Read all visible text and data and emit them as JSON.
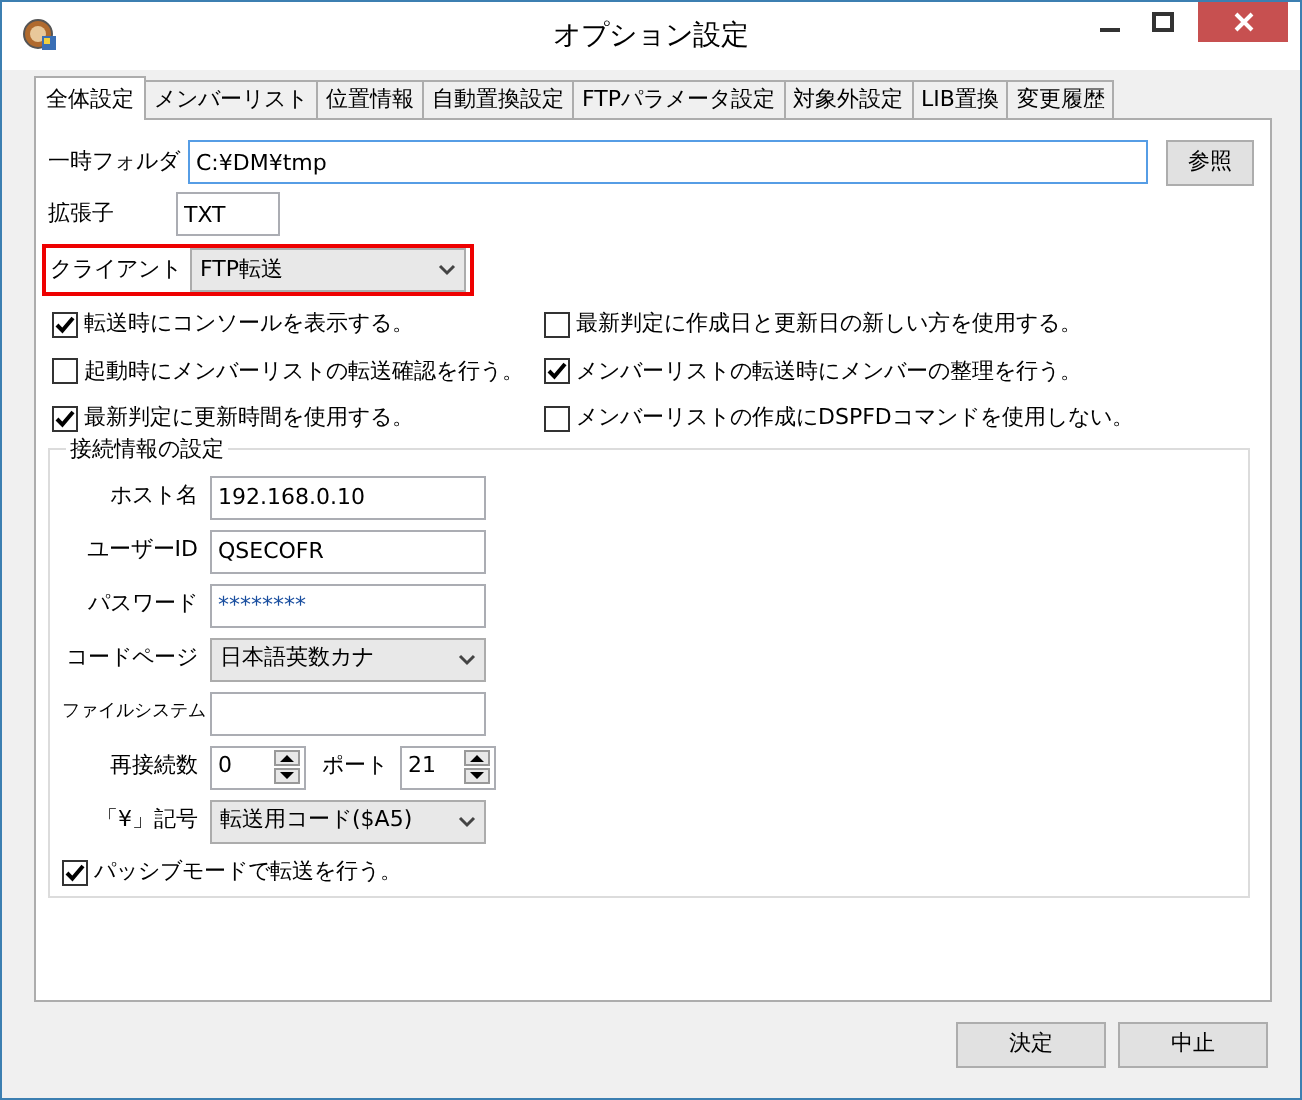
{
  "window": {
    "title": "オプション設定"
  },
  "tabs": [
    {
      "label": "全体設定",
      "selected": true
    },
    {
      "label": "メンバーリスト",
      "selected": false
    },
    {
      "label": "位置情報",
      "selected": false
    },
    {
      "label": "自動置換設定",
      "selected": false
    },
    {
      "label": "FTPパラメータ設定",
      "selected": false
    },
    {
      "label": "対象外設定",
      "selected": false
    },
    {
      "label": "LIB置換",
      "selected": false
    },
    {
      "label": "変更履歴",
      "selected": false
    }
  ],
  "temp_folder": {
    "label": "一時フォルダ",
    "value": "C:¥DM¥tmp",
    "button": "参照"
  },
  "extension": {
    "label": "拡張子",
    "value": "TXT"
  },
  "client": {
    "label": "クライアント",
    "value": "FTP転送",
    "highlighted": true
  },
  "options": [
    {
      "label": "転送時にコンソールを表示する。",
      "checked": true
    },
    {
      "label": "最新判定に作成日と更新日の新しい方を使用する。",
      "checked": false
    },
    {
      "label": "起動時にメンバーリストの転送確認を行う。",
      "checked": false
    },
    {
      "label": "メンバーリストの転送時にメンバーの整理を行う。",
      "checked": true
    },
    {
      "label": "最新判定に更新時間を使用する。",
      "checked": true
    },
    {
      "label": "メンバーリストの作成にDSPFDコマンドを使用しない。",
      "checked": false
    }
  ],
  "connection": {
    "title": "接続情報の設定",
    "fields": [
      {
        "kind": "text",
        "label": "ホスト名",
        "value": "192.168.0.10"
      },
      {
        "kind": "text",
        "label": "ユーザーID",
        "value": "QSECOFR"
      },
      {
        "kind": "password",
        "label": "パスワード",
        "value": "********"
      },
      {
        "kind": "select",
        "label": "コードページ",
        "value": "日本語英数カナ"
      },
      {
        "kind": "text",
        "label": "ファイルシステム"
      },
      {
        "kind": "spinners",
        "label": "再接続数",
        "value": "0",
        "label_2": "ポート",
        "value_2": "21"
      },
      {
        "kind": "select",
        "label": "「¥」記号",
        "value": "転送用コード($A5)"
      }
    ],
    "passive": {
      "label": "パッシブモードで転送を行う。",
      "checked": true
    }
  },
  "buttons": [
    "決定",
    "中止"
  ]
}
